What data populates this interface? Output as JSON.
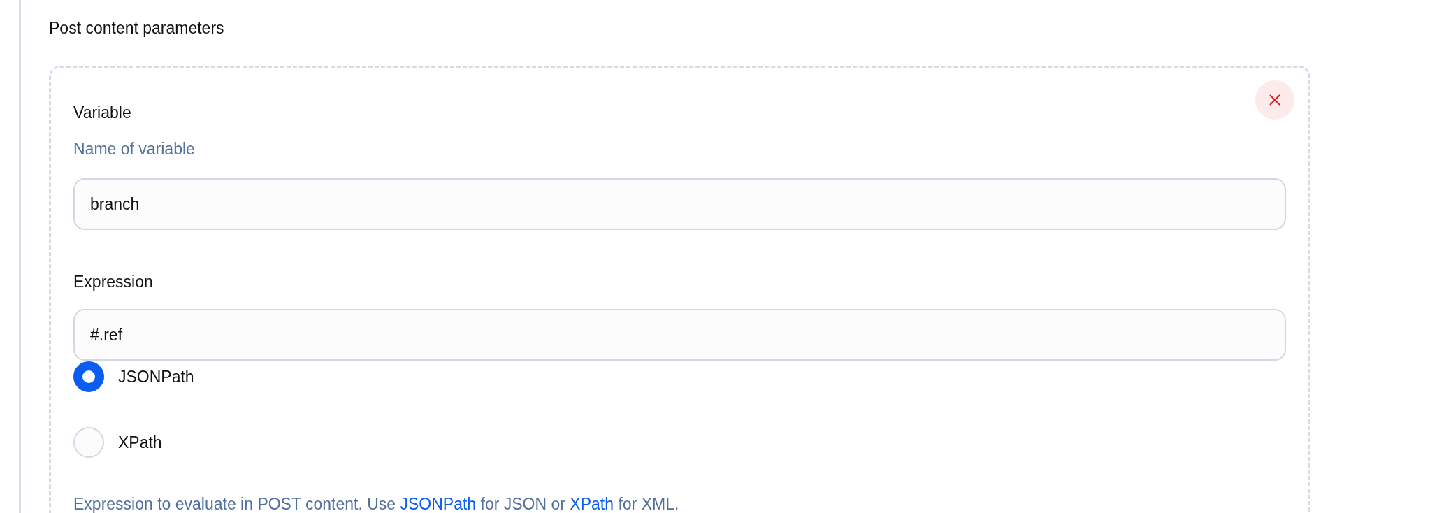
{
  "section": {
    "title": "Post content parameters"
  },
  "parameter": {
    "variable": {
      "label": "Variable",
      "description": "Name of variable",
      "value": "branch"
    },
    "expression": {
      "label": "Expression",
      "value": "#.ref"
    },
    "expression_type": [
      {
        "label": "JSONPath",
        "selected": true
      },
      {
        "label": "XPath",
        "selected": false
      }
    ],
    "help": [
      {
        "kind": "text",
        "text": "Expression to evaluate in POST content. Use "
      },
      {
        "kind": "link",
        "text": "JSONPath"
      },
      {
        "kind": "text",
        "text": " for JSON or "
      },
      {
        "kind": "link",
        "text": "XPath"
      },
      {
        "kind": "text",
        "text": " for XML."
      }
    ]
  }
}
